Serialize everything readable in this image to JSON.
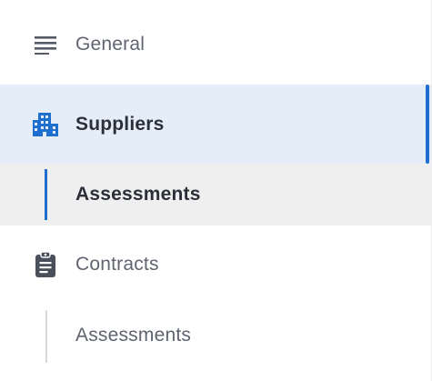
{
  "nav": {
    "items": [
      {
        "label": "General",
        "icon": "list-lines-icon"
      },
      {
        "label": "Suppliers",
        "icon": "building-icon",
        "active": true
      },
      {
        "label": "Assessments",
        "parent": "Suppliers",
        "active": true
      },
      {
        "label": "Contracts",
        "icon": "clipboard-icon"
      },
      {
        "label": "Assessments",
        "parent": "Contracts"
      }
    ]
  },
  "colors": {
    "accent": "#1e6fd0",
    "active_bg": "#e5eef8",
    "sub_active_bg": "#efefef",
    "text_muted": "#5f6470",
    "text_strong": "#2a2f38"
  }
}
